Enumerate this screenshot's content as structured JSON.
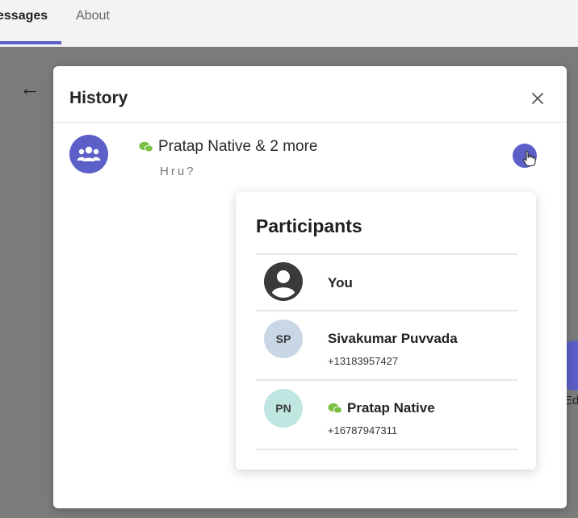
{
  "tabs": [
    {
      "label": "essages"
    },
    {
      "label": "About"
    }
  ],
  "background": {
    "side_text": "Ed"
  },
  "dialog": {
    "title": "History",
    "chat": {
      "title": "Pratap Native & 2 more",
      "preview": "Hru?"
    }
  },
  "participants": {
    "title": "Participants",
    "items": [
      {
        "name": "You",
        "phone": "",
        "initials": "",
        "icon": "person-icon"
      },
      {
        "name": "Sivakumar Puvvada",
        "phone": "+13183957427",
        "initials": "SP"
      },
      {
        "name": "Pratap Native",
        "phone": "+16787947311",
        "initials": "PN",
        "badge_icon": "wechat-icon"
      }
    ]
  },
  "colors": {
    "accent": "#5b5fc7",
    "wechat": "#7bc043",
    "backdrop": "#7b7b7b"
  }
}
